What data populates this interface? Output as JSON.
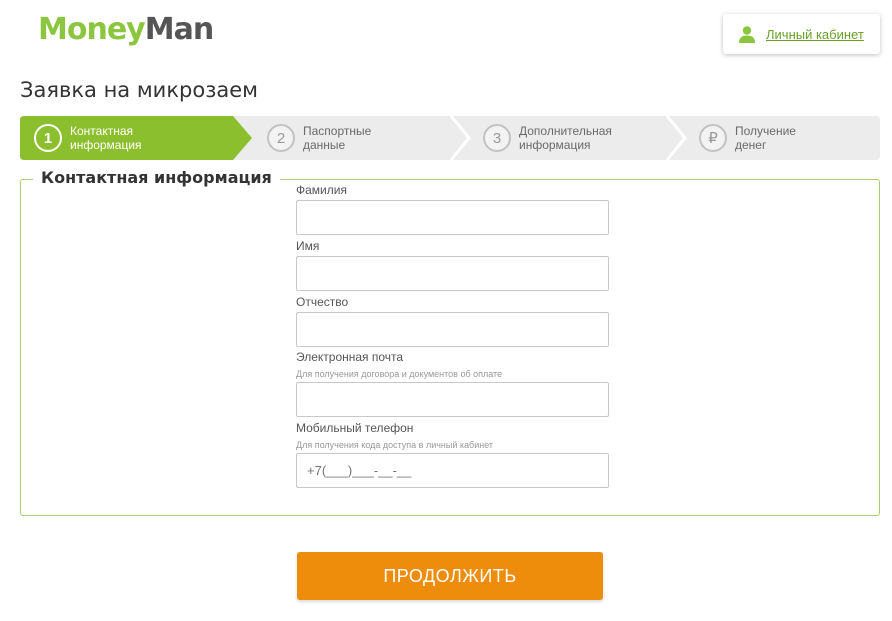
{
  "brand": {
    "part1": "Money",
    "part2": "Man"
  },
  "header": {
    "cabinet_label": "Личный кабинет",
    "cabinet_icon": "user-icon"
  },
  "page": {
    "title": "Заявка на микрозаем"
  },
  "steps": [
    {
      "num": "1",
      "label": "Контактная\nинформация",
      "active": true
    },
    {
      "num": "2",
      "label": "Паспортные\nданные",
      "active": false
    },
    {
      "num": "3",
      "label": "Дополнительная\nинформация",
      "active": false
    },
    {
      "num": "₽",
      "label": "Получение\nденег",
      "active": false
    }
  ],
  "form": {
    "legend": "Контактная информация",
    "fields": [
      {
        "label": "Фамилия",
        "hint": "",
        "value": "",
        "placeholder": ""
      },
      {
        "label": "Имя",
        "hint": "",
        "value": "",
        "placeholder": ""
      },
      {
        "label": "Отчество",
        "hint": "",
        "value": "",
        "placeholder": ""
      },
      {
        "label": "Электронная почта",
        "hint": "Для получения договора и документов об оплате",
        "value": "",
        "placeholder": ""
      },
      {
        "label": "Мобильный телефон",
        "hint": "Для получения кода доступа в личный кабинет",
        "value": "",
        "placeholder": "+7(___)___-__-__"
      }
    ]
  },
  "actions": {
    "continue_label": "ПРОДОЛЖИТЬ"
  },
  "colors": {
    "brand_green": "#8cc63f",
    "active_step": "#8cbf2e",
    "link_green": "#6a9f2a",
    "fieldset_border": "#a9cf6f",
    "button_orange": "#ee8c0c"
  }
}
